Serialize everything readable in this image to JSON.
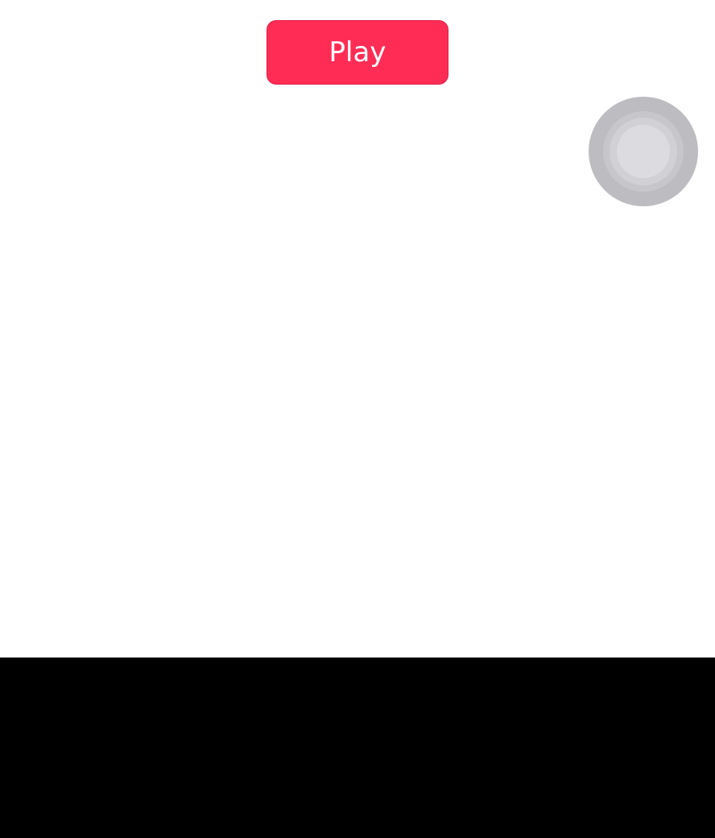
{
  "play_button": {
    "label": "Play",
    "color": "#ff2d55"
  },
  "assistive_touch": {
    "icon": "assistive-touch-icon"
  },
  "bottom_bar": {
    "color": "#000000"
  }
}
